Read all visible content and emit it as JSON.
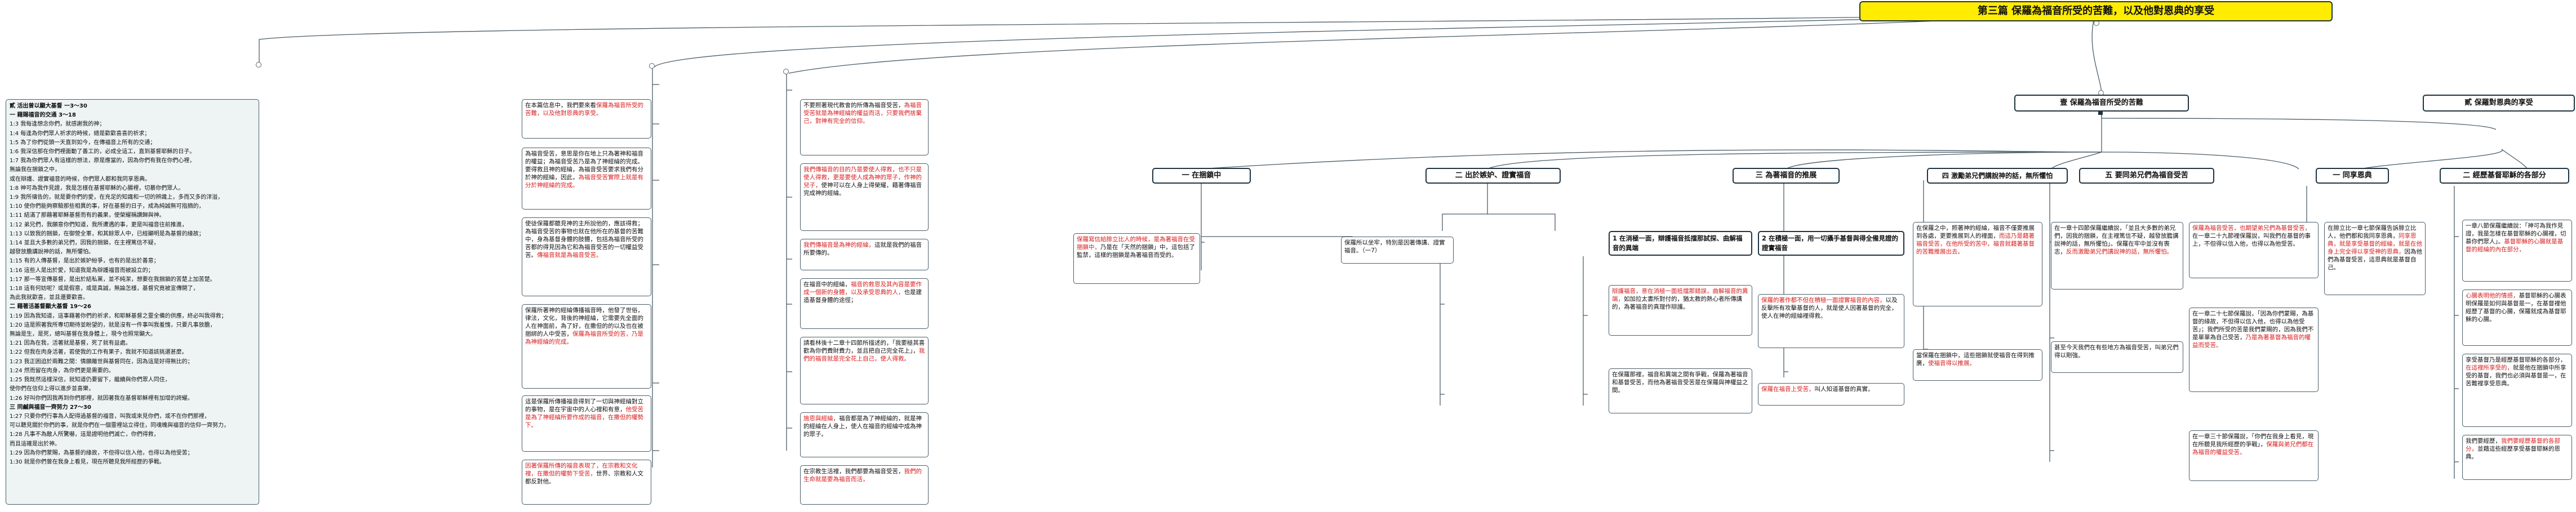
{
  "colors": {
    "accent_red": "#d81e1e",
    "root_fill": "#ffec00",
    "connector": "#4a5e6a",
    "tint": "#eef3f3"
  },
  "root": {
    "title": "第三篇 保羅為福音所受的苦難，以及他對恩典的享受"
  },
  "left_outline": {
    "lines": [
      "貳 活出曾以顯大基督 一3～30",
      "一 藉賜福音的交通 3～18",
      "1:3 我每逢想念你們，就感謝我的神；",
      "1:4 每逢為你們眾人祈求的時候，總是歡歡喜喜的祈求；",
      "1:5 為了你們從頭一天直到如今，在傳福音上所有的交通；",
      "1:6 我深信那在你們裡面動了善工的，必成全這工，直到基督耶穌的日子。",
      "1:7 我為你們眾人有這樣的想法，原是應當的，因為你們有我在你們心裡，",
      "無論我在捆鎖之中，",
      "或在辯護、證實福音的時候，你們眾人都和我同享恩典。",
      "1:8 神可為我作見證，我是怎樣在基督耶穌的心腸裡，切慕你們眾人。",
      "1:9 我所禱告的，就是要你們的愛，在充足的知識和一切的辨識上，多而又多的洋溢，",
      "1:10 使你們能夠察驗那些相異的事，好在基督的日子，成為純誠無可指摘的，",
      "1:11 結滿了那藉著耶穌基督而有的義果，使榮耀稱讚歸與神。",
      "1:12 弟兄們，我願意你們知道，我所遭遇的事，更是叫福音往前推進，",
      "1:13 以致我的捆鎖，在御營全軍，和其餘眾人中，已經顯明是為基督的緣故；",
      "1:14 並且大多數的弟兄們，因我的捆鎖，在主裡篤信不疑，",
      "越發放膽講說神的話，無所懼怕。",
      "1:15 有的人傳基督，是出於嫉妒紛爭，也有的是出於善意；",
      "1:16 這些人是出於愛，知道我是為辯護福音而被設立的；",
      "1:17 那一等宣傳基督，是出於結私黨，並不純潔，想要在我捆鎖的苦楚上加苦楚。",
      "1:18 這有何妨呢？或是假意，或是真誠，無論怎樣，基督究竟被宣傳開了，",
      "為此我就歡喜，並且還要歡喜。",
      "二 藉著活基督顯大基督 19～26",
      "1:19 因為我知道，這事藉著你們的祈求，和耶穌基督之靈全備的供應，終必叫我得救；",
      "1:20 這是照著我所專切期待並盼望的，就是沒有一件事叫我羞愧，只要凡事放膽，",
      "無論是生，是死，總叫基督在我身體上，現今也照常顯大。",
      "1:21 因為在我，活著就是基督，死了就有益處。",
      "1:22 但我在肉身活著，若使我的工作有果子，我就不知道該挑選甚麼。",
      "1:23 我正困迫於兩難之間：情願離世與基督同在，因為這是好得無比的；",
      "1:24 然而留在肉身，為你們更是需要的。",
      "1:25 我既然這樣深信，就知道仍要留下，繼續與你們眾人同住，",
      "使你們在信仰上得以進步並喜樂，",
      "1:26 好叫你們因我再到你們那裡，就因著我在基督耶穌裡有加增的誇耀。",
      "三 同鹹與福音一齊努力 27～30",
      "1:27 只要你們行事為人配得過基督的福音，叫我或來見你們，或不在你們那裡，",
      "可以聽見關於你們的事，就是你們在一個靈裡站立得住，同魂魄與福音的信仰一齊努力，",
      "1:28 凡事不為敵人所驚嚇，這是證明他們滅亡，你們得救，",
      "而且這確是出於神。",
      "1:29 因為你們蒙賜，為基督的緣故，不但得以信入他，也得以為他受苦；",
      "1:30 就是你們曾在我身上看見，現在所聽見我所經歷的爭戰。"
    ]
  },
  "col1": {
    "c1_1": {
      "black": "在本篇信息中，我們要來看",
      "red": "保羅為福音所受的苦難，以及他對恩典的享受。"
    },
    "c1_2": {
      "black": "為福音受苦，意思是你在地上只為著神和福音的權益；為福音受苦乃是為了神經綸的完成。要得救且神的經綸，為福音受苦要求我們有分於神的經綸，因此，",
      "red": "為福音受苦實際上就是有分於神經綸的完成。"
    },
    "c1_3": {
      "black": "使徒保羅都聽見神的主所說他的，應該得救；為福音受苦的事物也就在他所在的基督的苦難中，身為基督身體的肢體，包括為福音所受的苦都的得見因為它和為福音受苦的一切權益受苦。",
      "red": "傳福音就是為福音受苦。"
    },
    "c1_4": {
      "black": "保羅所著神的經綸傳播福音時，他發了世俗，律法，文化，背後的神經綸，它需要先全面的人在神面前，為了好，在撒但的的以及也在被捆綁的人中受苦，",
      "red": "保羅為福音所受的苦，乃是為神經綸的完成。"
    },
    "c1_5": {
      "black": "這是保羅所傳播福音得到了一切與神經綸對立的事物，是在宇宙中的人心裡和有意，",
      "red": "他受苦是為了神經綸所要作成的福音，在撒但的權勢下。"
    },
    "c1_6": {
      "red": "因著保羅所傳的福音表現了，在宗教和文化裡，在撒但的權勢下受苦，",
      "black": "世界、宗教和人文都反對他。"
    }
  },
  "col2": {
    "c2_1": {
      "black": "不要照著現代教會的所傳為福音受苦，",
      "red": "為福音受苦就是為神經綸的權益而活，只要我們捨棄己，對神有完全的信仰。"
    },
    "c2_2": {
      "red": "我們傳福音的目的乃是要使人得救，也不只是使人得救，更是要使人成為神的眾子，作神的兒子，",
      "black": "使神可以在人身上得榮耀，藉著傳福音完成神的經綸。"
    },
    "c2_3": {
      "red": "我們傳福音是為神的經綸，",
      "black": "這就是我們的福音所要傳的。"
    },
    "c2_4": {
      "black": "在福音中的經綸，",
      "red": "福音的救恩及其內容是要作成一個新的身體，以及承受恩典的人，",
      "black2": "也是建造基督身體的途徑；"
    },
    "c2_5": {
      "black": "請看林後十二章十四節所描述的，「我要極其喜歡為你們費財費力，並且把自己完全花上」，",
      "red": "我們的福音就是完全花上自己，使人得救。"
    },
    "c2_6": {
      "red": "施恩與經綸，",
      "black": "福音都是為了神經綸的，就是神的經綸在人身上，使人在福音的經綸中成為神的眾子。"
    },
    "c2_7": {
      "black": "在宗教生活裡，我們都要為福音受苦，",
      "red": "我們的生命就是要為福音而活，"
    }
  },
  "branch_a": {
    "label": "壹 保羅為福音所受的苦難"
  },
  "branch_b": {
    "label": "貳 保羅對恩典的享受"
  },
  "a_subs": {
    "a1": {
      "label": "一 在捆鎖中"
    },
    "a2": {
      "label": "二 出於嫉妒、證實福音"
    },
    "a3": {
      "label": "三 為著福音的推展"
    },
    "a4": {
      "label": "四 激勵弟兄們講說神的話，無所懼怕"
    },
    "a5": {
      "label": "五 要同弟兄們為福音受苦"
    }
  },
  "a1_notes": {
    "n1": {
      "red": "保羅寫信給腓立比人的時候，是為著福音在受捆鎖中，",
      "black": "乃是在「天然的捆鎖」中，這包括了監禁，這樣的捆鎖是為著福音而受的。"
    },
    "n2": {
      "black": "保羅所以坐牢，特別是因著傳講、證實福音。（一7）"
    }
  },
  "a2_subs": {
    "s1": {
      "label": "1 在消極一面，辯護福音抵擋那試探、曲解福音的異端"
    },
    "s2": {
      "label": "2 在積極一面，用一切攝手基督與得全備見證的證實福音"
    }
  },
  "a2_notes": {
    "n1": {
      "red": "辯護福音，意在消極一面抵擋那錯誤，曲解福音的異端，",
      "black": "如加拉太書所對付的，猶太教的熱心者所傳講的，為著福音的真理作辯護。"
    },
    "n2": {
      "black": "在保羅那裡，福音和異端之間有爭戰，保羅為著福音和基督受苦，而他為著福音受苦是在保羅與神權益之間。"
    },
    "n3": {
      "red": "保羅的著作都不但在積極一面證實福音的內容，",
      "black": "以及反擊所有攻擊基督的人，就是使人因著基督的完全，使人在神的經綸裡得救。"
    },
    "n4": {
      "red": "保羅在福音上受苦，",
      "black": "叫人知道基督的真實。"
    }
  },
  "a3_notes": {
    "n1": {
      "black": "在保羅之中，照著神的經綸，福音不僅要推展到各處，更要推展到人的裡面，",
      "red": "而這乃是藉著福音受苦，在他所受的苦中，福音就藉著基督的苦難推展出去。"
    },
    "n2": {
      "black": "當保羅在捆鎖中，這些捆鎖就使福音在得到推廣，",
      "red": "使福音得以推展。"
    }
  },
  "a4_notes": {
    "n1": {
      "black": "在一章十四節保羅繼續說，「並且大多數的弟兄們，因我的捆鎖，在主裡篤信不疑，越發放膽講說神的話，無所懼怕」。保羅在牢中並沒有喪志，",
      "red": "反而激勵弟兄們講說神的話，無所懼怕。"
    },
    "n2": {
      "black": "甚至今天我們在有些地方為福音受苦，叫弟兄們得以剛強。"
    }
  },
  "a5_notes": {
    "n1": {
      "red": "保羅為福音受苦，也期望弟兄們為基督受苦，",
      "black": "在一章二十九節裡保羅說，叫我們在基督的事上，不但得以信入他，也得以為他受苦。"
    },
    "n2": {
      "black": "在一章二十七節保羅說，「因為你們蒙賜，為基督的緣故，不但得以信入他，也得以為他受苦」；我們所受的苦是我們蒙賜的，因為我們不是單單為自己受苦，",
      "red": "乃是為著基督為福音的權益而受苦。"
    },
    "n3": {
      "black": "在一章三十節保羅說，「你們在我身上看見，現在所聽見我所經歷的爭戰」，",
      "red": "保羅與弟兄們都在為福音的權益受苦。"
    }
  },
  "b_subs": {
    "b1": {
      "label": "一 同享恩典"
    },
    "b2": {
      "label": "二 經歷基督耶穌的各部分"
    }
  },
  "b1_notes": {
    "n1": {
      "black": "在腓立比一章七節保羅告訴腓立比人，他們都和我同享恩典，",
      "red": "同享恩典，就是享受基督的經綸，就是在他身上完全得以享受神的恩典，",
      "black2": "因為他們為基督受苦，這恩典就是基督自己。"
    }
  },
  "b2_notes": {
    "n1": {
      "black": "一章八節保羅繼續說：「神可為我作見證，我是怎樣在基督耶穌的心腸裡，切慕你們眾人」。",
      "red": "基督耶穌的心腸就是基督的經綸的內在部分，"
    },
    "n2": {
      "red": "心腸表明他的情感，",
      "black": "基督耶穌的心腸表明保羅是如何與基督是一，在基督裡他經歷了基督的心腸，保羅就成為基督耶穌的心腸。"
    },
    "n3": {
      "black": "享受基督乃是經歷基督耶穌的各部分，",
      "red": "在這裡所享受的，",
      "black2": "就是他在捆鎖中所享受的基督，我們也必須與基督是一，在苦難裡享受恩典。"
    },
    "n4": {
      "black": "我們要經歷，",
      "red": "我們要經歷基督的各部分，",
      "black2": "並藉這些經歷享受基督耶穌的恩典。"
    }
  }
}
